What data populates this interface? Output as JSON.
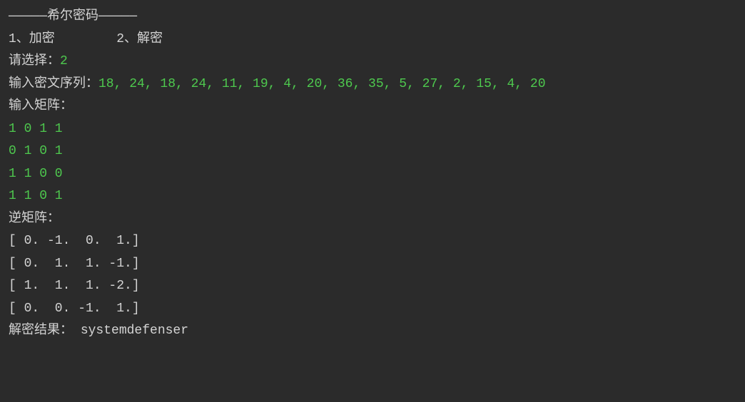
{
  "title": "—————希尔密码—————",
  "menu": {
    "option1": "1、加密",
    "spacer": "        ",
    "option2": "2、解密"
  },
  "prompt_choice": "请选择：",
  "choice_value": "2",
  "prompt_cipher": "输入密文序列：",
  "cipher_value": "18, 24, 18, 24, 11, 19, 4, 20, 36, 35, 5, 27, 2, 15, 4, 20",
  "prompt_matrix": "输入矩阵：",
  "matrix_rows": [
    "1 0 1 1",
    "0 1 0 1",
    "1 1 0 0",
    "1 1 0 1"
  ],
  "inverse_label": "逆矩阵：",
  "inverse_rows": [
    "[ 0. -1.  0.  1.]",
    "[ 0.  1.  1. -1.]",
    "[ 1.  1.  1. -2.]",
    "[ 0.  0. -1.  1.]"
  ],
  "result_label": "解密结果： ",
  "result_value": "systemdefenser"
}
